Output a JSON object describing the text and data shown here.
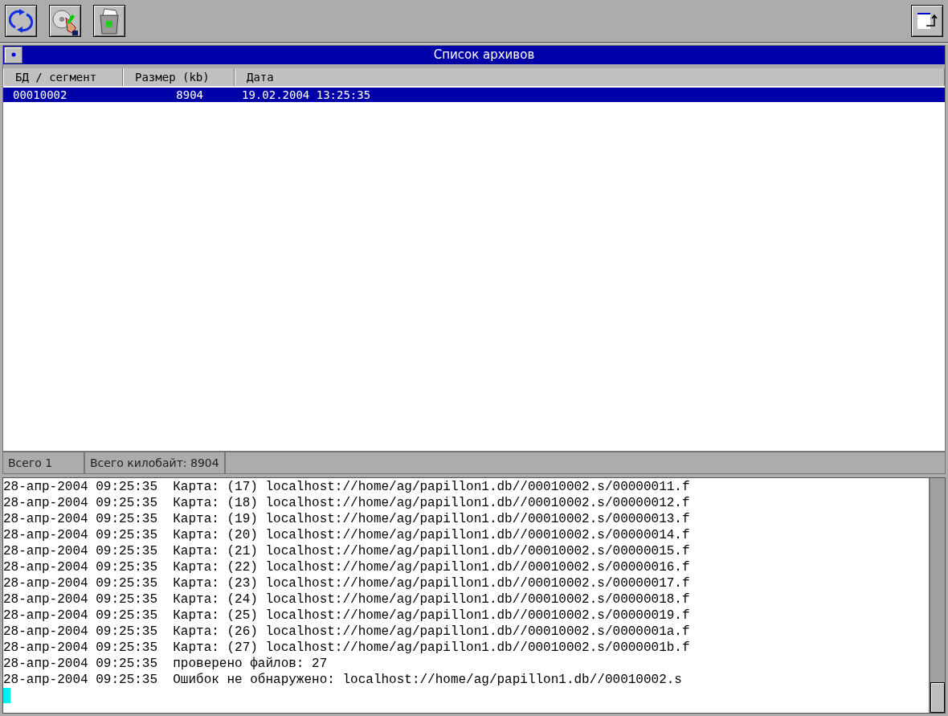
{
  "toolbar": {
    "buttons": [
      {
        "kind": "refresh"
      },
      {
        "kind": "disc"
      },
      {
        "kind": "trash"
      }
    ],
    "right_button": {
      "kind": "window"
    }
  },
  "archive_list": {
    "title": "Список архивов",
    "columns": [
      "БД / сегмент",
      "Размер (kb)",
      "Дата"
    ],
    "rows": [
      {
        "cells": [
          "00010002",
          "8904",
          "19.02.2004 13:25:35"
        ],
        "selected": true
      }
    ]
  },
  "status_bar": [
    "Всего 1",
    "Всего килобайт: 8904"
  ],
  "log": [
    "28-апр-2004 09:25:35  Карта: (17) localhost://home/ag/papillon1.db//00010002.s/00000011.f",
    "28-апр-2004 09:25:35  Карта: (18) localhost://home/ag/papillon1.db//00010002.s/00000012.f",
    "28-апр-2004 09:25:35  Карта: (19) localhost://home/ag/papillon1.db//00010002.s/00000013.f",
    "28-апр-2004 09:25:35  Карта: (20) localhost://home/ag/papillon1.db//00010002.s/00000014.f",
    "28-апр-2004 09:25:35  Карта: (21) localhost://home/ag/papillon1.db//00010002.s/00000015.f",
    "28-апр-2004 09:25:35  Карта: (22) localhost://home/ag/papillon1.db//00010002.s/00000016.f",
    "28-апр-2004 09:25:35  Карта: (23) localhost://home/ag/papillon1.db//00010002.s/00000017.f",
    "28-апр-2004 09:25:35  Карта: (24) localhost://home/ag/papillon1.db//00010002.s/00000018.f",
    "28-апр-2004 09:25:35  Карта: (25) localhost://home/ag/papillon1.db//00010002.s/00000019.f",
    "28-апр-2004 09:25:35  Карта: (26) localhost://home/ag/papillon1.db//00010002.s/0000001a.f",
    "28-апр-2004 09:25:35  Карта: (27) localhost://home/ag/papillon1.db//00010002.s/0000001b.f",
    "28-апр-2004 09:25:35  проверено файлов: 27",
    "28-апр-2004 09:25:35  Ошибок не обнаружено: localhost://home/ag/papillon1.db//00010002.s"
  ]
}
